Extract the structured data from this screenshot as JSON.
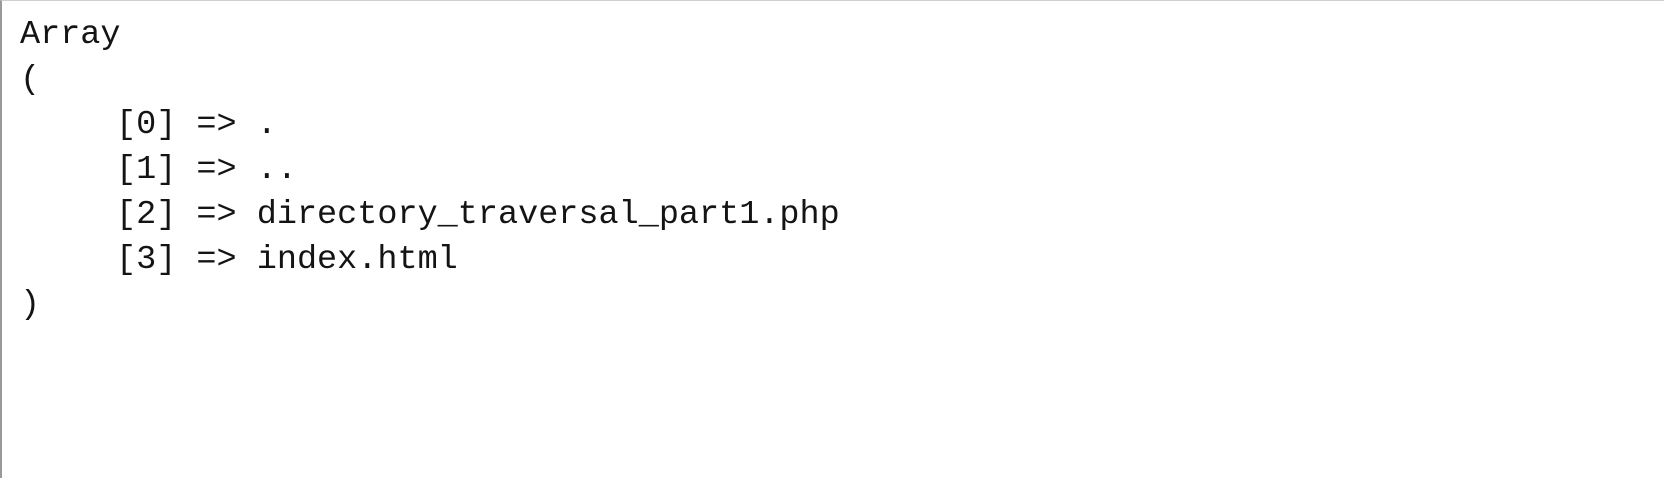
{
  "print_r": {
    "header": "Array",
    "open_paren": "(",
    "entries": [
      {
        "key": "[0]",
        "arrow": "=>",
        "value": "."
      },
      {
        "key": "[1]",
        "arrow": "=>",
        "value": ".."
      },
      {
        "key": "[2]",
        "arrow": "=>",
        "value": "directory_traversal_part1.php"
      },
      {
        "key": "[3]",
        "arrow": "=>",
        "value": "index.html"
      }
    ],
    "close_paren": ")"
  }
}
